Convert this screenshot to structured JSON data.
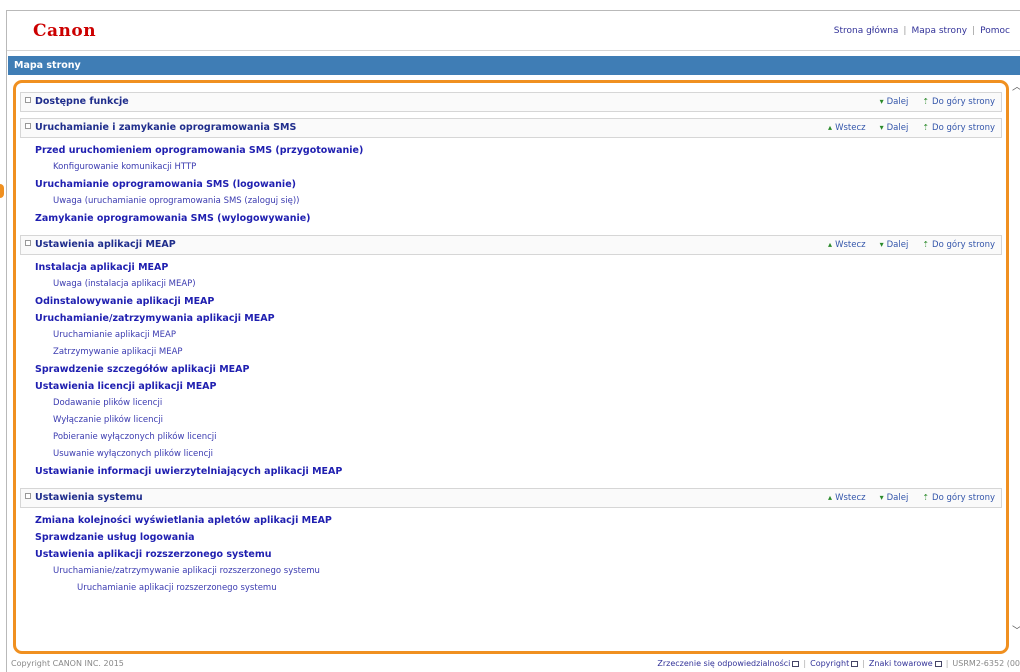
{
  "header": {
    "logo": "Canon",
    "links": [
      "Strona główna",
      "Mapa strony",
      "Pomoc"
    ]
  },
  "title_bar": "Mapa strony",
  "sections": [
    {
      "title": "Dostępne funkcje",
      "nav": [
        "Dalej",
        "Do góry strony"
      ],
      "items": []
    },
    {
      "title": "Uruchamianie i zamykanie oprogramowania SMS",
      "nav": [
        "Wstecz",
        "Dalej",
        "Do góry strony"
      ],
      "items": [
        {
          "level": 1,
          "text": "Przed uruchomieniem oprogramowania SMS (przygotowanie)"
        },
        {
          "level": 2,
          "text": "Konfigurowanie komunikacji HTTP"
        },
        {
          "level": 1,
          "text": "Uruchamianie oprogramowania SMS (logowanie)"
        },
        {
          "level": 2,
          "text": "Uwaga (uruchamianie oprogramowania SMS (zaloguj się))"
        },
        {
          "level": 1,
          "text": "Zamykanie oprogramowania SMS (wylogowywanie)"
        }
      ]
    },
    {
      "title": "Ustawienia aplikacji MEAP",
      "nav": [
        "Wstecz",
        "Dalej",
        "Do góry strony"
      ],
      "items": [
        {
          "level": 1,
          "text": "Instalacja aplikacji MEAP"
        },
        {
          "level": 2,
          "text": "Uwaga (instalacja aplikacji MEAP)"
        },
        {
          "level": 1,
          "text": "Odinstalowywanie aplikacji MEAP"
        },
        {
          "level": 1,
          "text": "Uruchamianie/zatrzymywania aplikacji MEAP"
        },
        {
          "level": 2,
          "text": "Uruchamianie aplikacji MEAP"
        },
        {
          "level": 2,
          "text": "Zatrzymywanie aplikacji MEAP"
        },
        {
          "level": 1,
          "text": "Sprawdzenie szczegółów aplikacji MEAP"
        },
        {
          "level": 1,
          "text": "Ustawienia licencji aplikacji MEAP"
        },
        {
          "level": 2,
          "text": "Dodawanie plików licencji"
        },
        {
          "level": 2,
          "text": "Wyłączanie plików licencji"
        },
        {
          "level": 2,
          "text": "Pobieranie wyłączonych plików licencji"
        },
        {
          "level": 2,
          "text": "Usuwanie wyłączonych plików licencji"
        },
        {
          "level": 1,
          "text": "Ustawianie informacji uwierzytelniających aplikacji MEAP"
        }
      ]
    },
    {
      "title": "Ustawienia systemu",
      "nav": [
        "Wstecz",
        "Dalej",
        "Do góry strony"
      ],
      "items": [
        {
          "level": 1,
          "text": "Zmiana kolejności wyświetlania apletów aplikacji MEAP"
        },
        {
          "level": 1,
          "text": "Sprawdzanie usług logowania"
        },
        {
          "level": 1,
          "text": "Ustawienia aplikacji rozszerzonego systemu"
        },
        {
          "level": 2,
          "text": "Uruchamianie/zatrzymywanie aplikacji rozszerzonego systemu"
        },
        {
          "level": 3,
          "text": "Uruchamianie aplikacji rozszerzonego systemu"
        }
      ]
    }
  ],
  "footer": {
    "copyright": "Copyright CANON INC. 2015",
    "links": [
      "Zrzeczenie się odpowiedzialności",
      "Copyright",
      "Znaki towarowe"
    ],
    "code": "USRM2-6352 (00"
  },
  "colors": {
    "brand": "#cc0000",
    "title_bar": "#3f7db5",
    "callout": "#f09020",
    "link": "#1f1fb0"
  }
}
